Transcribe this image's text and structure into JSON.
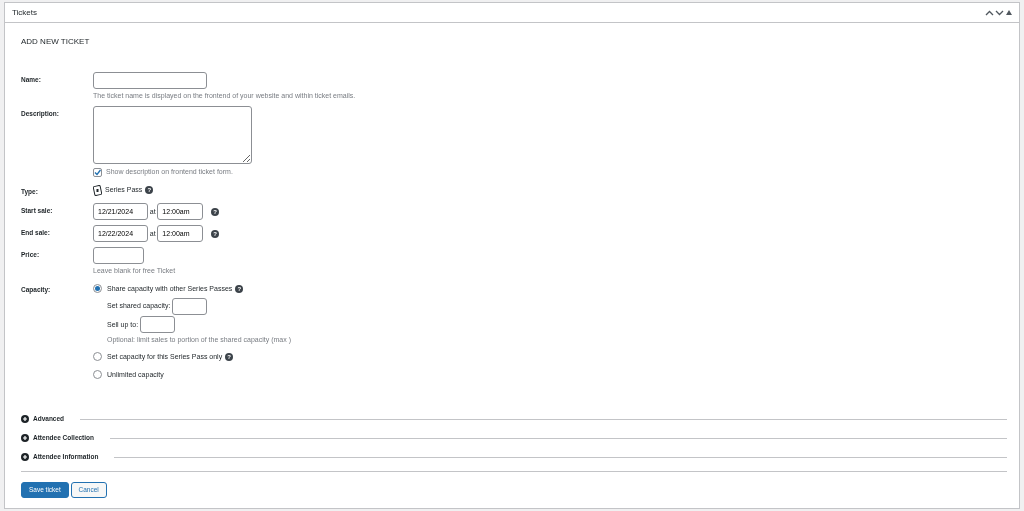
{
  "panel": {
    "title": "Tickets"
  },
  "heading": "ADD NEW TICKET",
  "name": {
    "label": "Name:",
    "hint": "The ticket name is displayed on the frontend of your website and within ticket emails."
  },
  "description": {
    "label": "Description:",
    "show": {
      "label": "Show description on frontend ticket form.",
      "checked": true
    }
  },
  "type": {
    "label": "Type:",
    "value": "Series Pass",
    "help": "?"
  },
  "start_sale": {
    "label": "Start sale:",
    "date": "12/21/2024",
    "at": "at",
    "time": "12:00am",
    "help": "?"
  },
  "end_sale": {
    "label": "End sale:",
    "date": "12/22/2024",
    "at": "at",
    "time": "12:00am",
    "help": "?"
  },
  "price": {
    "label": "Price:",
    "hint": "Leave blank for free Ticket"
  },
  "capacity": {
    "label": "Capacity:",
    "shared_label": "Set shared capacity:",
    "sell_label": "Sell up to:",
    "optional_hint": "Optional: limit sales to portion of the shared capacity (max )",
    "options": [
      {
        "label": "Share capacity with other Series Passes",
        "selected": true,
        "help": "?"
      },
      {
        "label": "Set capacity for this Series Pass only",
        "selected": false,
        "help": "?"
      },
      {
        "label": "Unlimited capacity",
        "selected": false
      }
    ]
  },
  "sections": [
    {
      "label": "Advanced"
    },
    {
      "label": "Attendee Collection"
    },
    {
      "label": "Attendee Information"
    }
  ],
  "buttons": [
    {
      "label": "Save ticket",
      "kind": "primary"
    },
    {
      "label": "Cancel",
      "kind": "secondary"
    }
  ]
}
